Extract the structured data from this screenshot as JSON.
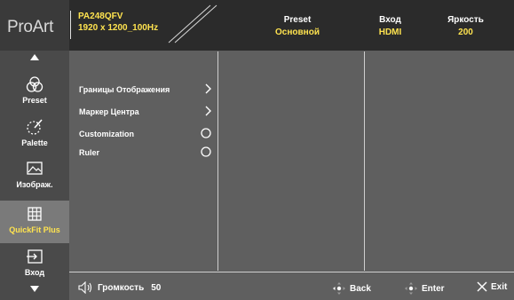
{
  "header": {
    "brand": "ProArt",
    "model": "PA248QFV",
    "resolution": "1920 x 1200_100Hz",
    "status": [
      {
        "label": "Preset",
        "value": "Основной"
      },
      {
        "label": "Вход",
        "value": "HDMI"
      },
      {
        "label": "Яркость",
        "value": "200"
      }
    ]
  },
  "sidebar": {
    "items": [
      {
        "label": "Preset",
        "icon": "preset-icon"
      },
      {
        "label": "Palette",
        "icon": "palette-icon"
      },
      {
        "label": "Изображ.",
        "icon": "image-icon"
      },
      {
        "label": "QuickFit Plus",
        "icon": "quickfit-grid-icon",
        "active": true
      },
      {
        "label": "Вход",
        "icon": "input-icon"
      }
    ]
  },
  "menu": {
    "items": [
      {
        "label": "Границы Отображения",
        "control": "chevron-right-icon"
      },
      {
        "label": "Маркер Центра",
        "control": "chevron-right-icon"
      },
      {
        "label": "Customization",
        "control": "radio-icon"
      },
      {
        "label": "Ruler",
        "control": "radio-icon"
      }
    ]
  },
  "footer": {
    "volume_label": "Громкость",
    "volume_value": "50",
    "back": "Back",
    "enter": "Enter",
    "exit": "Exit"
  },
  "colors": {
    "accent": "#ffe34f",
    "panel": "#5f5f5f",
    "header": "#2b2b2b",
    "sidebar": "#4a4a4a",
    "sidebar_active": "#7a7a7a"
  }
}
